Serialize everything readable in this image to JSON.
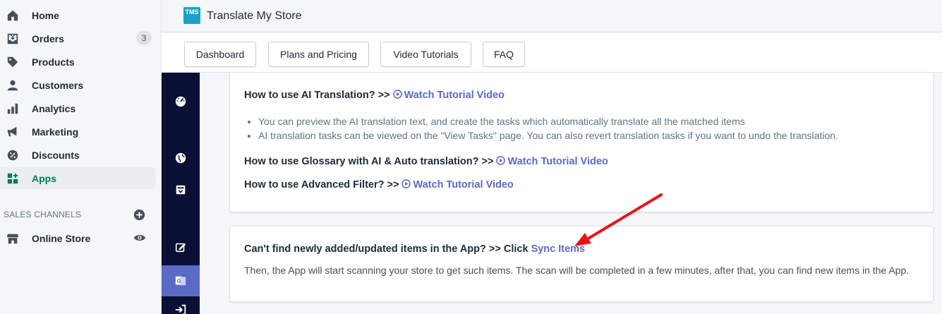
{
  "nav": {
    "items": [
      {
        "label": "Home",
        "icon": "home-icon"
      },
      {
        "label": "Orders",
        "icon": "orders-icon",
        "badge": "3"
      },
      {
        "label": "Products",
        "icon": "tag-icon"
      },
      {
        "label": "Customers",
        "icon": "person-icon"
      },
      {
        "label": "Analytics",
        "icon": "bar-chart-icon"
      },
      {
        "label": "Marketing",
        "icon": "megaphone-icon"
      },
      {
        "label": "Discounts",
        "icon": "discount-icon"
      },
      {
        "label": "Apps",
        "icon": "apps-icon",
        "active": true
      }
    ],
    "sales_channels_label": "SALES CHANNELS",
    "online_store_label": "Online Store"
  },
  "app": {
    "logo_text": "TMS",
    "title": "Translate My Store",
    "tabs": [
      "Dashboard",
      "Plans and Pricing",
      "Video Tutorials",
      "FAQ"
    ]
  },
  "card1": {
    "q1_text": "How to use AI Translation? >>",
    "q1_link": "Watch Tutorial Video",
    "bullets": [
      "You can preview the AI translation text, and create the tasks which automatically translate all the matched items",
      "AI translation tasks can be viewed on the \"View Tasks\" page. You can also revert translation tasks if you want to undo the translation."
    ],
    "q2_text": "How to use Glossary with AI & Auto translation? >>",
    "q2_link": "Watch Tutorial Video",
    "q3_text": "How to use Advanced Filter? >>",
    "q3_link": "Watch Tutorial Video"
  },
  "card2": {
    "question": "Can't find newly added/updated items in the App? >> Click",
    "link": "Sync Items",
    "description": "Then, the App will start scanning your store to get such items. The scan will be completed in a few minutes, after that, you can find new items in the App."
  },
  "colors": {
    "accent": "#5c6ac4",
    "rail": "#0a0f36",
    "active_green": "#007a5c",
    "annotation_arrow": "#e8141b"
  }
}
